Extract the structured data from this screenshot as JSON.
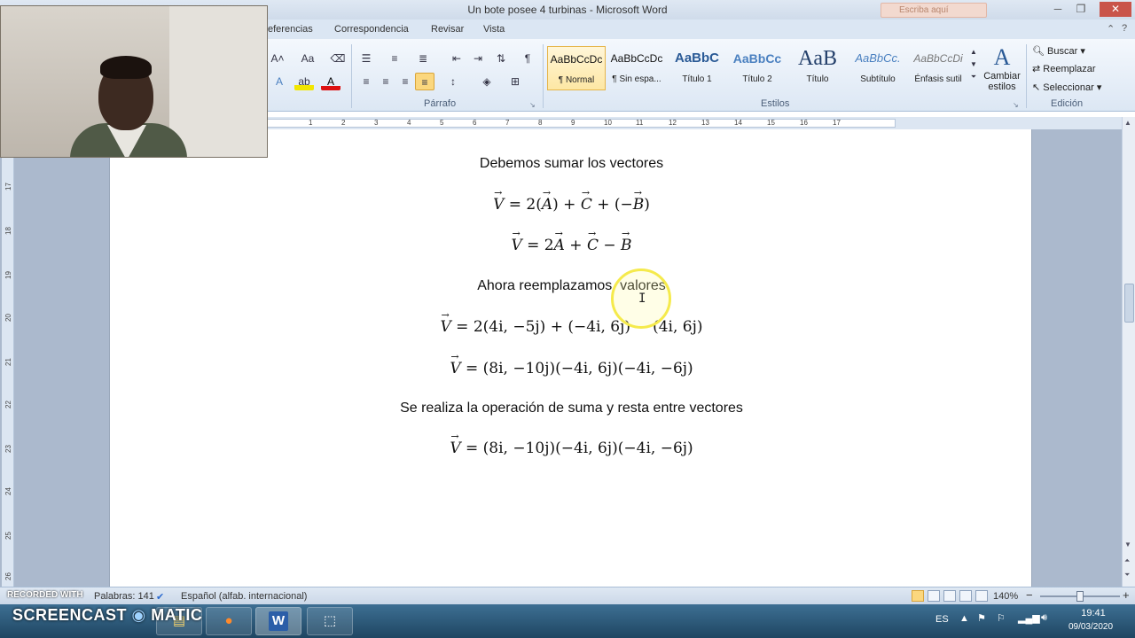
{
  "window": {
    "title": "Un bote posee 4 turbinas  -  Microsoft Word",
    "search_hint": "Escriba aquí",
    "minimize": "─",
    "maximize": "❐",
    "close": "✕"
  },
  "ribbon_tabs": [
    "eferencias",
    "Correspondencia",
    "Revisar",
    "Vista"
  ],
  "ribbon": {
    "paragraph_label": "Párrafo",
    "styles_label": "Estilos",
    "editing_label": "Edición",
    "font_size_up": "A",
    "change_case": "Aa",
    "font_color": "A",
    "styles": [
      {
        "sample": "AaBbCcDc",
        "name": "¶ Normal"
      },
      {
        "sample": "AaBbCcDc",
        "name": "¶ Sin espa..."
      },
      {
        "sample": "AaBbC",
        "name": "Título 1"
      },
      {
        "sample": "AaBbCc",
        "name": "Título 2"
      },
      {
        "sample": "AaB",
        "name": "Título"
      },
      {
        "sample": "AaBbCc.",
        "name": "Subtítulo"
      },
      {
        "sample": "AaBbCcDi",
        "name": "Énfasis sutil"
      }
    ],
    "change_styles": [
      "Cambiar",
      "estilos"
    ],
    "find": "Buscar",
    "replace": "Reemplazar",
    "select": "Seleccionar"
  },
  "ruler_numbers": [
    "1",
    "2",
    "3",
    "4",
    "5",
    "6",
    "7",
    "8",
    "9",
    "10",
    "11",
    "12",
    "13",
    "14",
    "15",
    "16",
    "17"
  ],
  "vruler_numbers": [
    "17",
    "18",
    "19",
    "20",
    "21",
    "22",
    "23",
    "24",
    "25",
    "26"
  ],
  "document": {
    "line1": "Debemos sumar los vectores",
    "line4": "Ahora reemplazamos  valores",
    "line7": "Se realiza la operación de suma y resta entre vectores",
    "eq1": {
      "v": "V",
      "a": "A",
      "c": "C",
      "b": "B"
    },
    "eq3_rest": " = 2(4i, −5j) + (−4i, 6j) − (4i, 6j)",
    "eq4_rest": " = (8i, −10j)(−4i, 6j)(−4i, −6j)",
    "eq5_rest": " = (8i, −10j)(−4i, 6j)(−4i, −6j)"
  },
  "statusbar": {
    "words": "Palabras: 141",
    "language": "Español (alfab. internacional)",
    "zoom": "140%",
    "zoom_out": "−",
    "zoom_in": "+"
  },
  "watermark": {
    "recorded": "RECORDED WITH",
    "brand": "SCREENCAST",
    "brand2": "MATIC"
  },
  "taskbar": {
    "language": "ES",
    "time": "19:41",
    "date": "09/03/2020",
    "word_app": "W"
  }
}
